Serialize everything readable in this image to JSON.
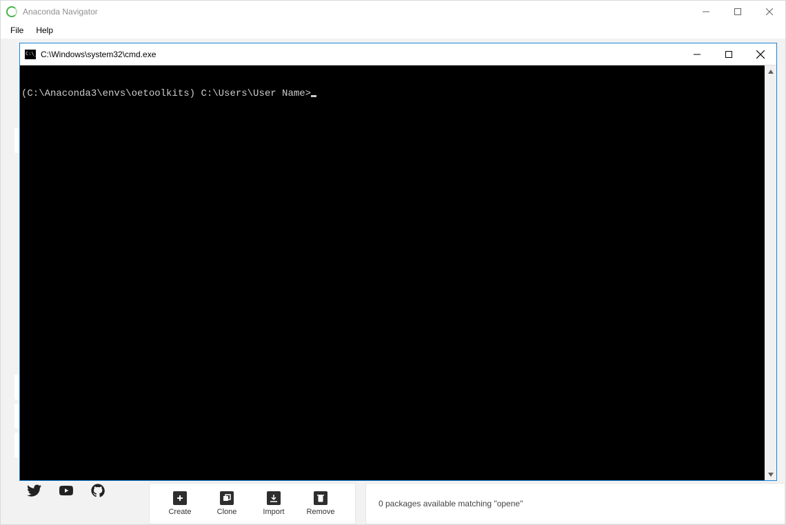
{
  "navigator": {
    "title": "Anaconda Navigator",
    "menu": {
      "file": "File",
      "help": "Help"
    },
    "actions": {
      "create": {
        "label": "Create"
      },
      "clone": {
        "label": "Clone"
      },
      "import": {
        "label": "Import"
      },
      "remove": {
        "label": "Remove"
      }
    },
    "status_text": "0 packages available matching \"opene\""
  },
  "cmd": {
    "title": "C:\\Windows\\system32\\cmd.exe",
    "prompt_line": "(C:\\Anaconda3\\envs\\oetoolkits) C:\\Users\\User Name>"
  }
}
